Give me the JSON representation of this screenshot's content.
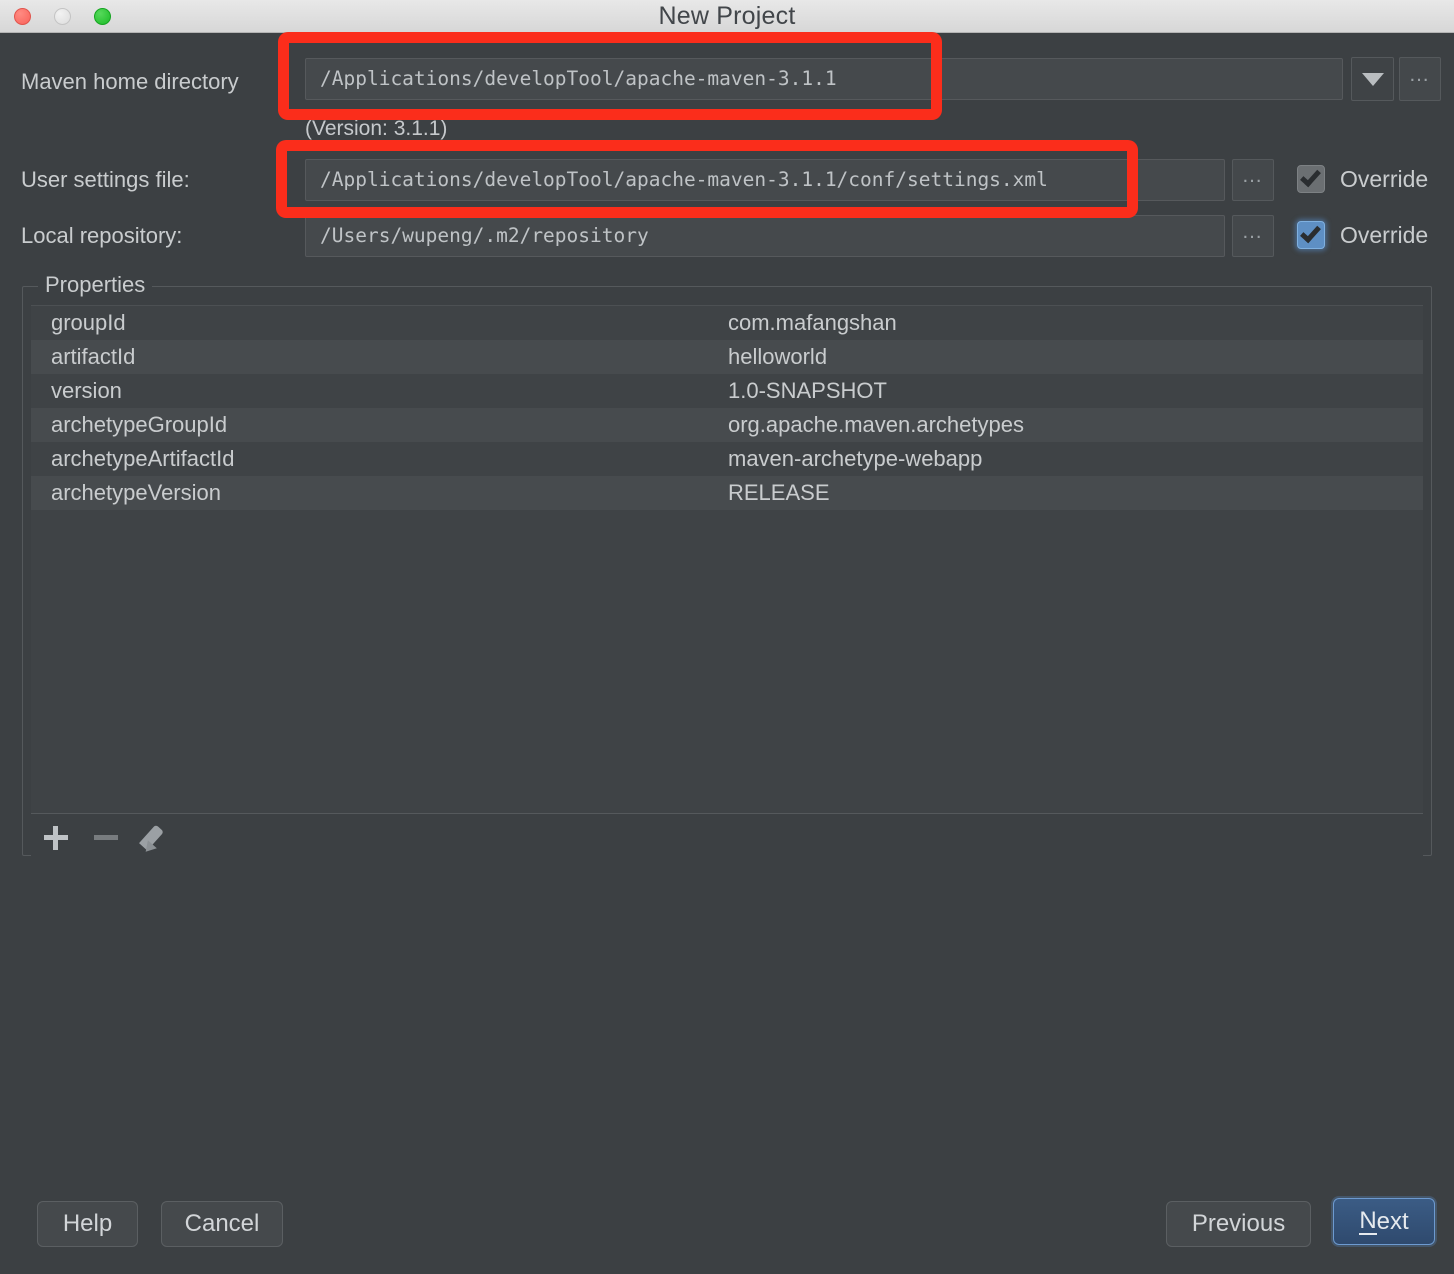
{
  "window": {
    "title": "New Project",
    "controls": [
      {
        "name": "close",
        "icon": "close-traffic-light"
      },
      {
        "name": "minimize",
        "icon": "minimize-traffic-light"
      },
      {
        "name": "maximize",
        "icon": "maximize-traffic-light"
      }
    ]
  },
  "form": {
    "maven_home": {
      "label": "Maven home directory",
      "value": "/Applications/developTool/apache-maven-3.1.1",
      "dropdown_icon": "chevron-down-icon",
      "browse_label": "…",
      "version_note": "(Version: 3.1.1)"
    },
    "user_settings": {
      "label": "User settings file:",
      "value": "/Applications/developTool/apache-maven-3.1.1/conf/settings.xml",
      "browse_label": "…",
      "override_label": "Override",
      "override_checked": true
    },
    "local_repository": {
      "label": "Local repository:",
      "value": "/Users/wupeng/.m2/repository",
      "browse_label": "…",
      "override_label": "Override",
      "override_checked": true
    }
  },
  "properties": {
    "group_title": "Properties",
    "rows": [
      {
        "key": "groupId",
        "value": "com.mafangshan"
      },
      {
        "key": "artifactId",
        "value": "helloworld"
      },
      {
        "key": "version",
        "value": "1.0-SNAPSHOT"
      },
      {
        "key": "archetypeGroupId",
        "value": "org.apache.maven.archetypes"
      },
      {
        "key": "archetypeArtifactId",
        "value": "maven-archetype-webapp"
      },
      {
        "key": "archetypeVersion",
        "value": "RELEASE"
      }
    ],
    "toolbar": [
      {
        "name": "add-property-button",
        "icon": "plus-icon",
        "enabled": true
      },
      {
        "name": "remove-property-button",
        "icon": "minus-icon",
        "enabled": false
      },
      {
        "name": "edit-property-button",
        "icon": "pencil-icon",
        "enabled": true
      }
    ]
  },
  "footer": {
    "help": "Help",
    "cancel": "Cancel",
    "previous": "Previous",
    "next_mnemonic": "N",
    "next_rest": "ext"
  },
  "annotations": [
    {
      "name": "highlight-maven-home-field",
      "shape": "rounded-rect",
      "color": "#fb2d1b"
    },
    {
      "name": "highlight-user-settings-field",
      "shape": "rounded-rect",
      "color": "#fb2d1b"
    }
  ]
}
